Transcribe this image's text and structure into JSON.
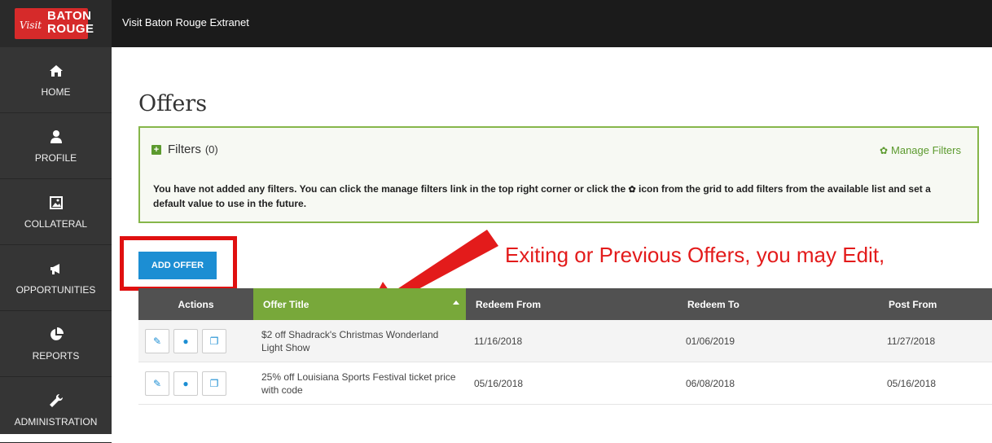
{
  "header": {
    "logo": {
      "visit": "Visit",
      "line1": "BATON",
      "line2": "ROUGE"
    },
    "app_title": "Visit Baton Rouge Extranet"
  },
  "sidebar": {
    "items": [
      {
        "label": "HOME",
        "icon": "home-icon"
      },
      {
        "label": "PROFILE",
        "icon": "user-icon"
      },
      {
        "label": "COLLATERAL",
        "icon": "image-icon"
      },
      {
        "label": "OPPORTUNITIES",
        "icon": "megaphone-icon"
      },
      {
        "label": "REPORTS",
        "icon": "pie-chart-icon"
      },
      {
        "label": "ADMINISTRATION",
        "icon": "wrench-icon"
      }
    ]
  },
  "page": {
    "title": "Offers"
  },
  "filters": {
    "label": "Filters",
    "count": "(0)",
    "manage_label": "Manage Filters",
    "message_part1": "You have not added any filters. You can click the manage filters link in the top right corner or click the ",
    "message_part2": " icon from the grid to add filters from the available list and set a default value to use in the future."
  },
  "add_offer_label": "ADD OFFER",
  "annotation": {
    "text": "Exiting or Previous Offers, you may Edit,",
    "color": "#e31b1b"
  },
  "grid": {
    "columns": [
      "Actions",
      "Offer Title",
      "Redeem From",
      "Redeem To",
      "Post From"
    ],
    "rows": [
      {
        "title": "$2 off Shadrack's Christmas Wonderland Light Show",
        "redeem_from": "11/16/2018",
        "redeem_to": "01/06/2019",
        "post_from": "11/27/2018"
      },
      {
        "title": "25% off Louisiana Sports Festival ticket price with code",
        "redeem_from": "05/16/2018",
        "redeem_to": "06/08/2018",
        "post_from": "05/16/2018"
      }
    ]
  },
  "colors": {
    "accent_green": "#78a83a",
    "button_blue": "#1c8ed3",
    "sidebar": "#353535",
    "highlight_red": "#e01010"
  }
}
